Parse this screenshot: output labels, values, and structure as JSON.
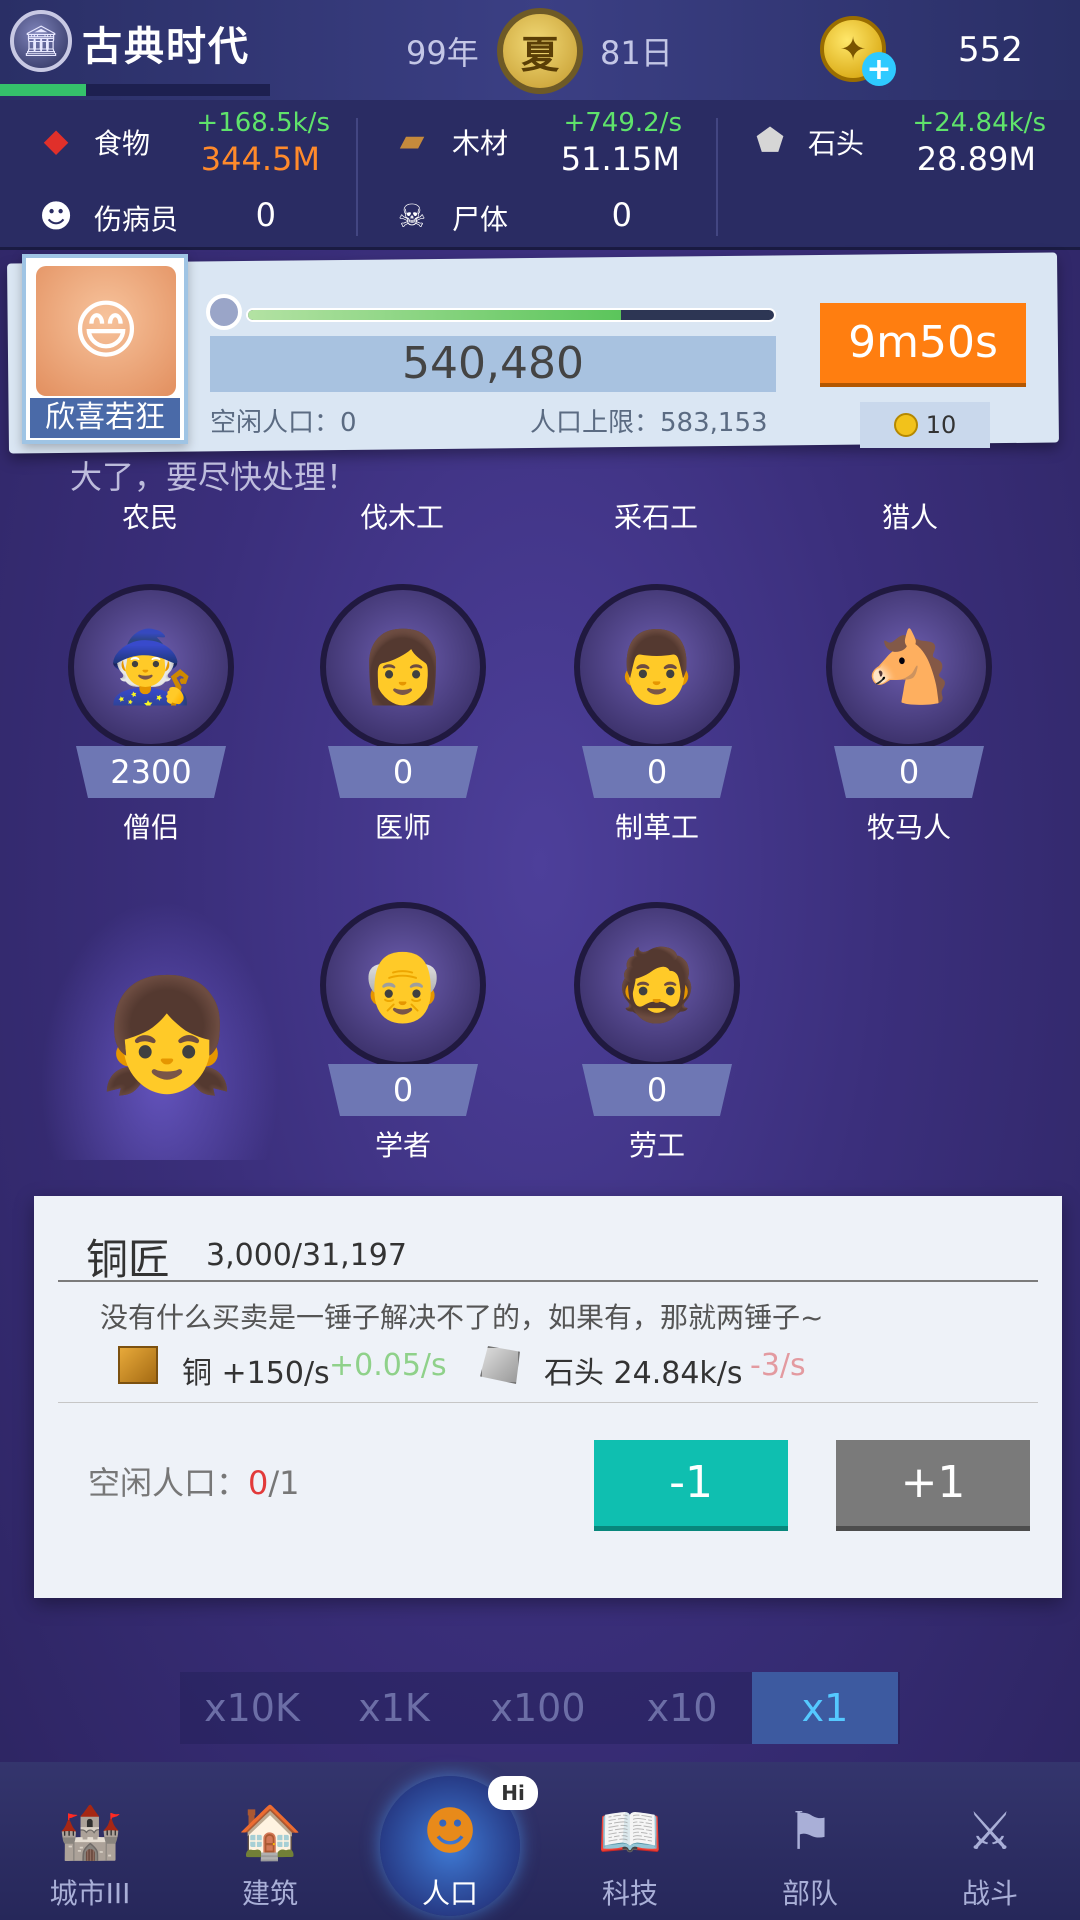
{
  "header": {
    "era_icon": "temple-icon",
    "era_title": "古典时代",
    "year": "99年",
    "season": "夏",
    "day": "81日",
    "coin_icon": "gold-coin-icon",
    "coins": "552",
    "era_progress": 0.32
  },
  "resources": [
    {
      "icon": "food-icon",
      "name": "食物",
      "rate": "+168.5k/s",
      "value": "344.5M",
      "value_color": "#ff8a2b"
    },
    {
      "icon": "wood-icon",
      "name": "木材",
      "rate": "+749.2/s",
      "value": "51.15M"
    },
    {
      "icon": "stone-icon",
      "name": "石头",
      "rate": "+24.84k/s",
      "value": "28.89M"
    },
    {
      "icon": "wounded-icon",
      "name": "伤病员",
      "value": "0"
    },
    {
      "icon": "corpse-icon",
      "name": "尸体",
      "value": "0"
    }
  ],
  "population": {
    "mood_label": "欣喜若狂",
    "total": "540,480",
    "idle_label": "空闲人口：",
    "idle_value": "0",
    "limit_label": "人口上限：",
    "limit_value": "583,153",
    "timer": "9m50s",
    "cost": "10",
    "progress": 0.71
  },
  "warning": "大了，要尽快处理！",
  "top_jobs": [
    "农民",
    "伐木工",
    "采石工",
    "猎人"
  ],
  "jobs": [
    {
      "name": "僧侣",
      "count": "2300",
      "icon": "monk-icon"
    },
    {
      "name": "医师",
      "count": "0",
      "icon": "doctor-icon"
    },
    {
      "name": "制革工",
      "count": "0",
      "icon": "tanner-icon"
    },
    {
      "name": "牧马人",
      "count": "0",
      "icon": "horse-herder-icon"
    },
    {
      "name": "学者",
      "count": "0",
      "icon": "scholar-icon"
    },
    {
      "name": "劳工",
      "count": "0",
      "icon": "laborer-icon"
    }
  ],
  "detail": {
    "title": "铜匠",
    "progress": "3,000/31,197",
    "description": "没有什么买卖是一锤子解决不了的，如果有，那就两锤子~",
    "output_name": "铜",
    "output_rate": "+150/s",
    "output_delta": "+0.05/s",
    "input_name": "石头",
    "input_rate": "24.84k/s",
    "input_delta": "-3/s",
    "idle_label": "空闲人口：",
    "idle_current": "0",
    "idle_total": "/1",
    "minus_label": "-1",
    "plus_label": "+1"
  },
  "multipliers": [
    "x10K",
    "x1K",
    "x100",
    "x10",
    "x1"
  ],
  "active_multiplier": "x1",
  "nav": [
    {
      "label": "城市III",
      "icon": "castle-icon"
    },
    {
      "label": "建筑",
      "icon": "house-icon"
    },
    {
      "label": "人口",
      "icon": "population-icon",
      "active": true
    },
    {
      "label": "科技",
      "icon": "book-icon"
    },
    {
      "label": "部队",
      "icon": "banner-icon"
    },
    {
      "label": "战斗",
      "icon": "crossed-swords-icon"
    }
  ],
  "hi_bubble": "Hi"
}
